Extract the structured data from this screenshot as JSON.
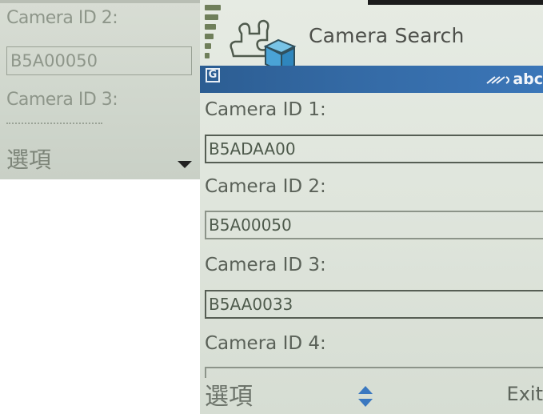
{
  "left_screen": {
    "camera_id_2_label": "Camera ID 2:",
    "camera_id_2_value": "B5A00050",
    "camera_id_3_label": "Camera ID 3:",
    "softkey_left": "選項",
    "scroll_icon": "arrow-down-icon"
  },
  "right_screen": {
    "header": {
      "title": "Camera Search",
      "app_icon": "puzzle-cube-icon",
      "signal_icon": "signal-strength-icon"
    },
    "status_bar": {
      "network_indicator": "G",
      "input_mode": "abc",
      "input_mode_icon": "pen-input-icon"
    },
    "fields": [
      {
        "label": "Camera ID 1:",
        "value": "B5ADAA00"
      },
      {
        "label": "Camera ID 2:",
        "value": "B5A00050"
      },
      {
        "label": "Camera ID 3:",
        "value": "B5AA0033"
      },
      {
        "label": "Camera ID 4:",
        "value": ""
      }
    ],
    "softkeys": {
      "left": "選項",
      "center_icon": "up-down-nav-icon",
      "right": "Exit"
    }
  },
  "colors": {
    "status_bar": "#346aa5",
    "screen_background": "#e2e8df",
    "text": "#5a6158",
    "nav_arrows": "#3a78c0"
  }
}
